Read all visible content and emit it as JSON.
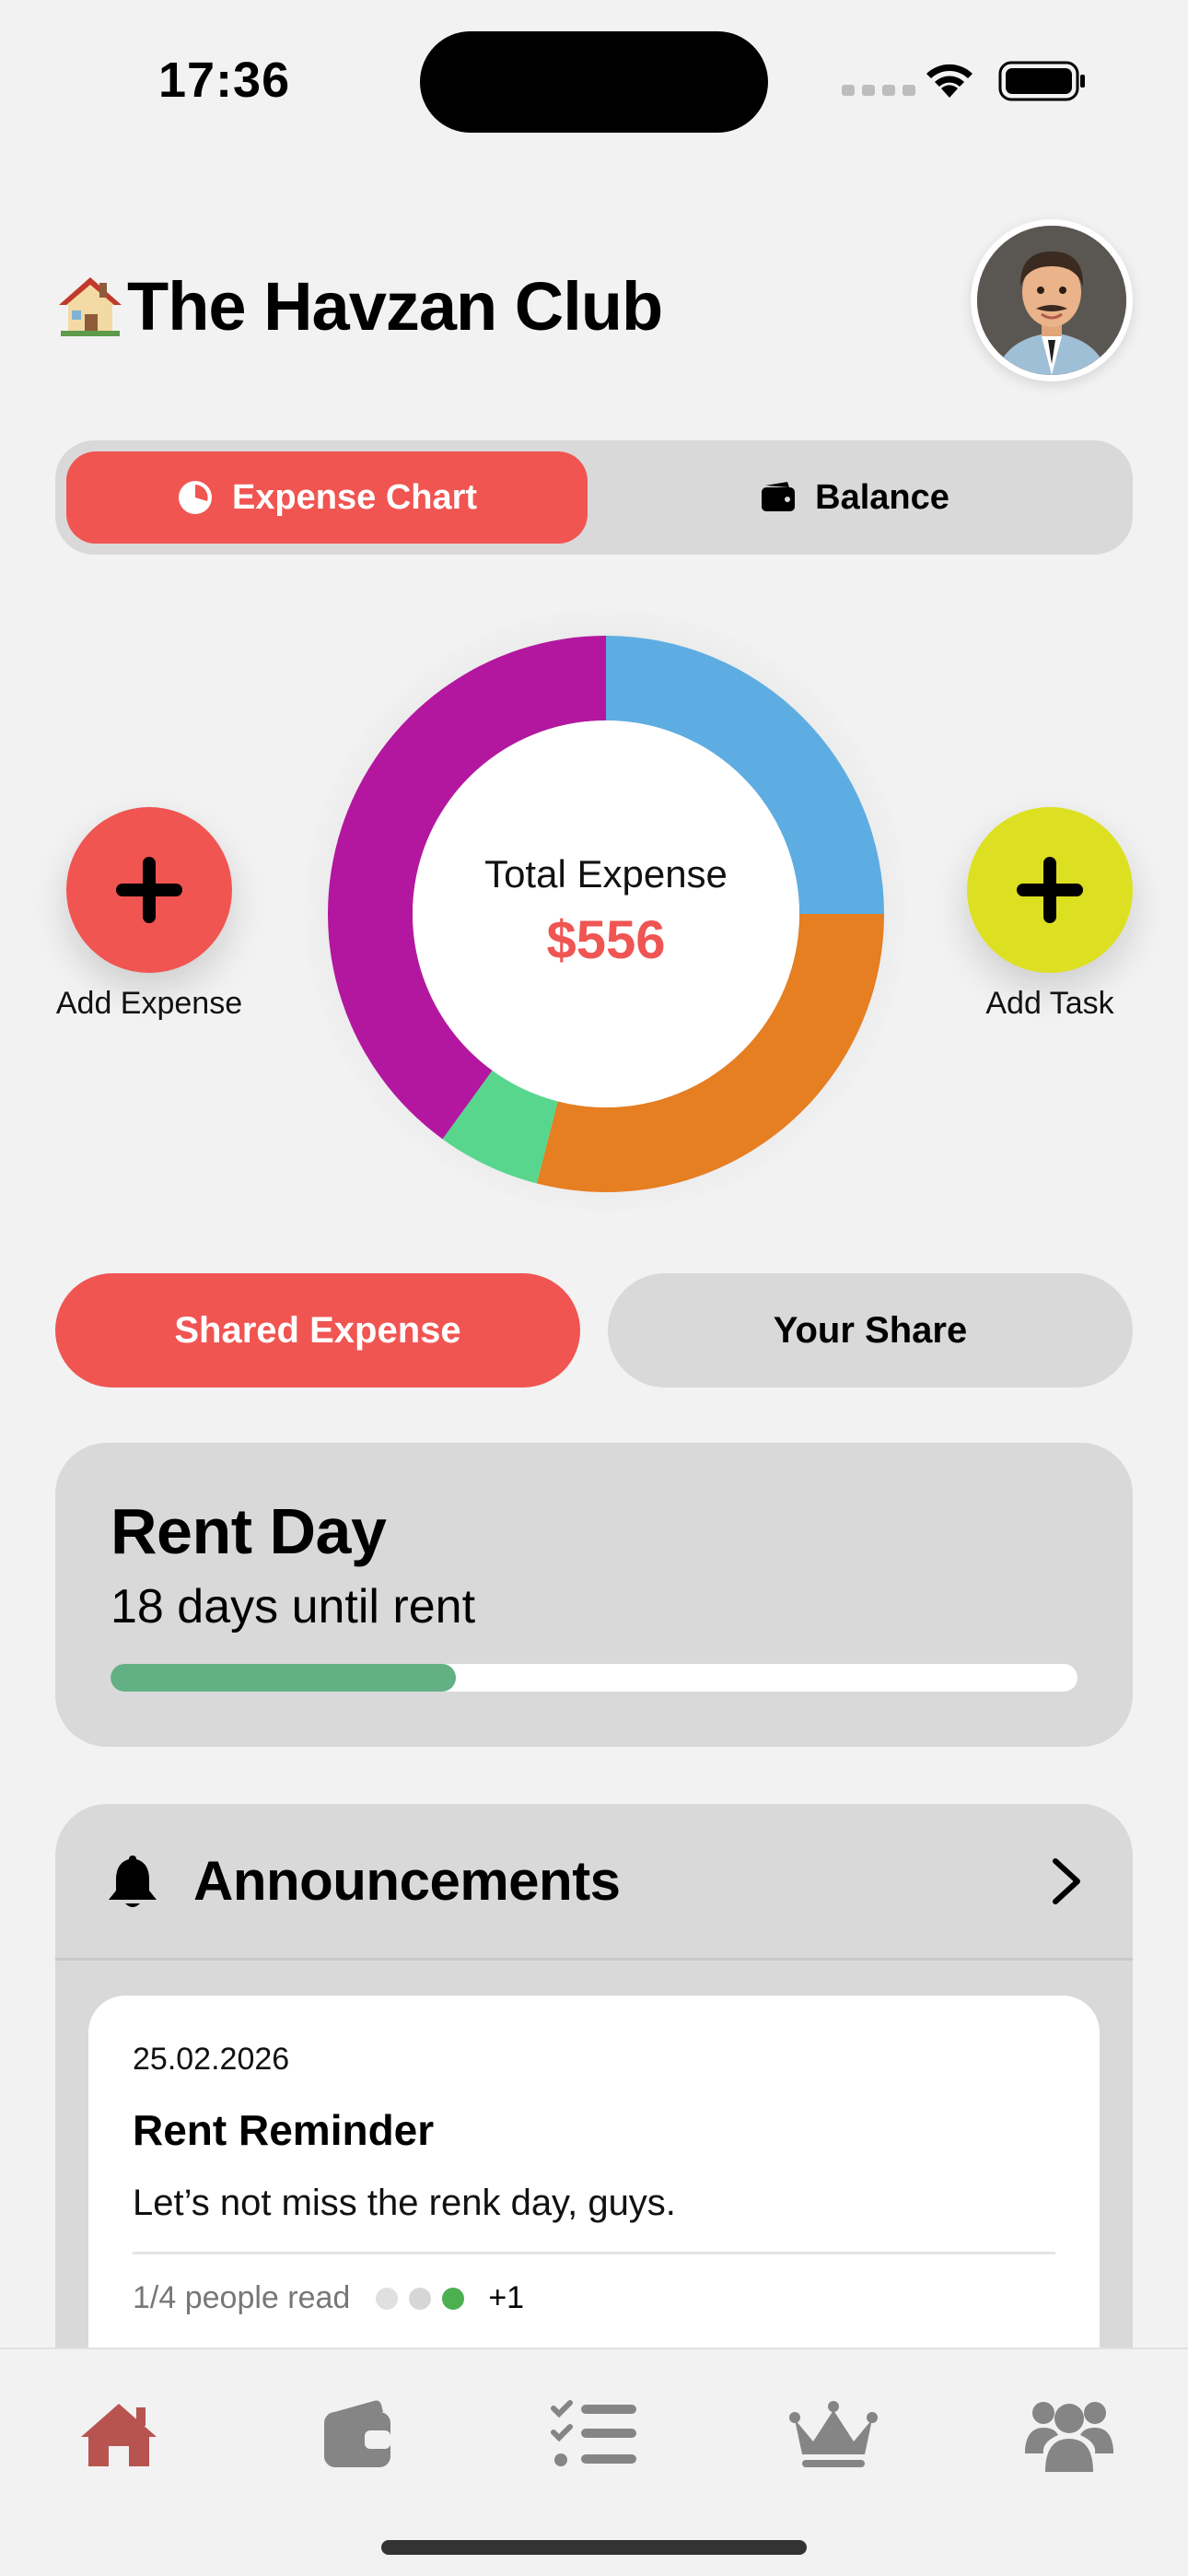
{
  "status_bar": {
    "time": "17:36"
  },
  "header": {
    "title": "The Havzan Club",
    "house_emoji": "🏠"
  },
  "segmented": {
    "expense_chart_label": "Expense Chart",
    "balance_label": "Balance"
  },
  "chart_data": {
    "type": "pie",
    "title": "",
    "center_label": "Total Expense",
    "center_value": "$556",
    "slices": [
      {
        "color": "#5dade2",
        "value": 25
      },
      {
        "color": "#e67e22",
        "value": 29
      },
      {
        "color": "#58d68d",
        "value": 6
      },
      {
        "color": "#b3179f",
        "value": 40
      }
    ]
  },
  "actions": {
    "add_expense_label": "Add Expense",
    "add_task_label": "Add Task"
  },
  "pills": {
    "shared_label": "Shared Expense",
    "your_share_label": "Your Share"
  },
  "rent": {
    "title": "Rent Day",
    "subtitle": "18 days until rent",
    "progress": 0.357
  },
  "announcements": {
    "title": "Announcements",
    "item": {
      "date": "25.02.2026",
      "title": "Rent Reminder",
      "body": "Let’s not miss the renk day, guys.",
      "read_text": "1/4 people read",
      "read_dot_colors": [
        "#e0e0e0",
        "#d6d6d6",
        "#4caf50"
      ],
      "extra_count": "+1"
    }
  },
  "tabs": [
    {
      "name": "home",
      "color": "#b85450"
    },
    {
      "name": "wallet",
      "color": "#858585"
    },
    {
      "name": "tasks",
      "color": "#858585"
    },
    {
      "name": "crown",
      "color": "#858585"
    },
    {
      "name": "group",
      "color": "#858585"
    }
  ],
  "colors": {
    "accent": "#f05552",
    "task": "#dde021",
    "progress": "#62b083"
  }
}
